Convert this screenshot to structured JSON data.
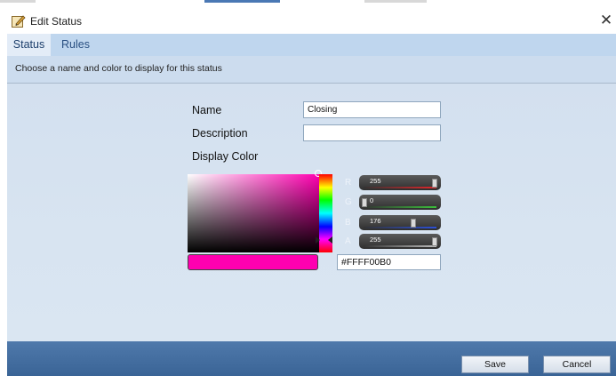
{
  "window": {
    "title": "Edit Status",
    "close_glyph": "✕",
    "icon": "edit-status-icon"
  },
  "tabs": [
    {
      "label": "Status",
      "active": true
    },
    {
      "label": "Rules",
      "active": false
    }
  ],
  "instruction": "Choose a name and color to display for this status",
  "form": {
    "name_label": "Name",
    "name_value": "Closing",
    "description_label": "Description",
    "description_value": "",
    "display_color_label": "Display Color"
  },
  "color": {
    "hex_value": "#FFFF00B0",
    "swatch": "#ff00b0",
    "channels": [
      {
        "letter": "R",
        "value": "255",
        "level": 1.0,
        "bar_color": "#e0262a"
      },
      {
        "letter": "G",
        "value": "0",
        "level": 0.0,
        "bar_color": "#3bbf3b"
      },
      {
        "letter": "B",
        "value": "176",
        "level": 0.69,
        "bar_color": "#2b4fd6"
      },
      {
        "letter": "A",
        "value": "255",
        "level": 1.0,
        "bar_color": "#bdbdbd"
      }
    ]
  },
  "buttons": {
    "save": "Save",
    "cancel": "Cancel"
  },
  "colors": {
    "tab_bar": "#bfd6ee",
    "active_tab": "#e3ecf7",
    "content_bg": "#d6e2f0",
    "bottom_bar": "#4570a3"
  }
}
